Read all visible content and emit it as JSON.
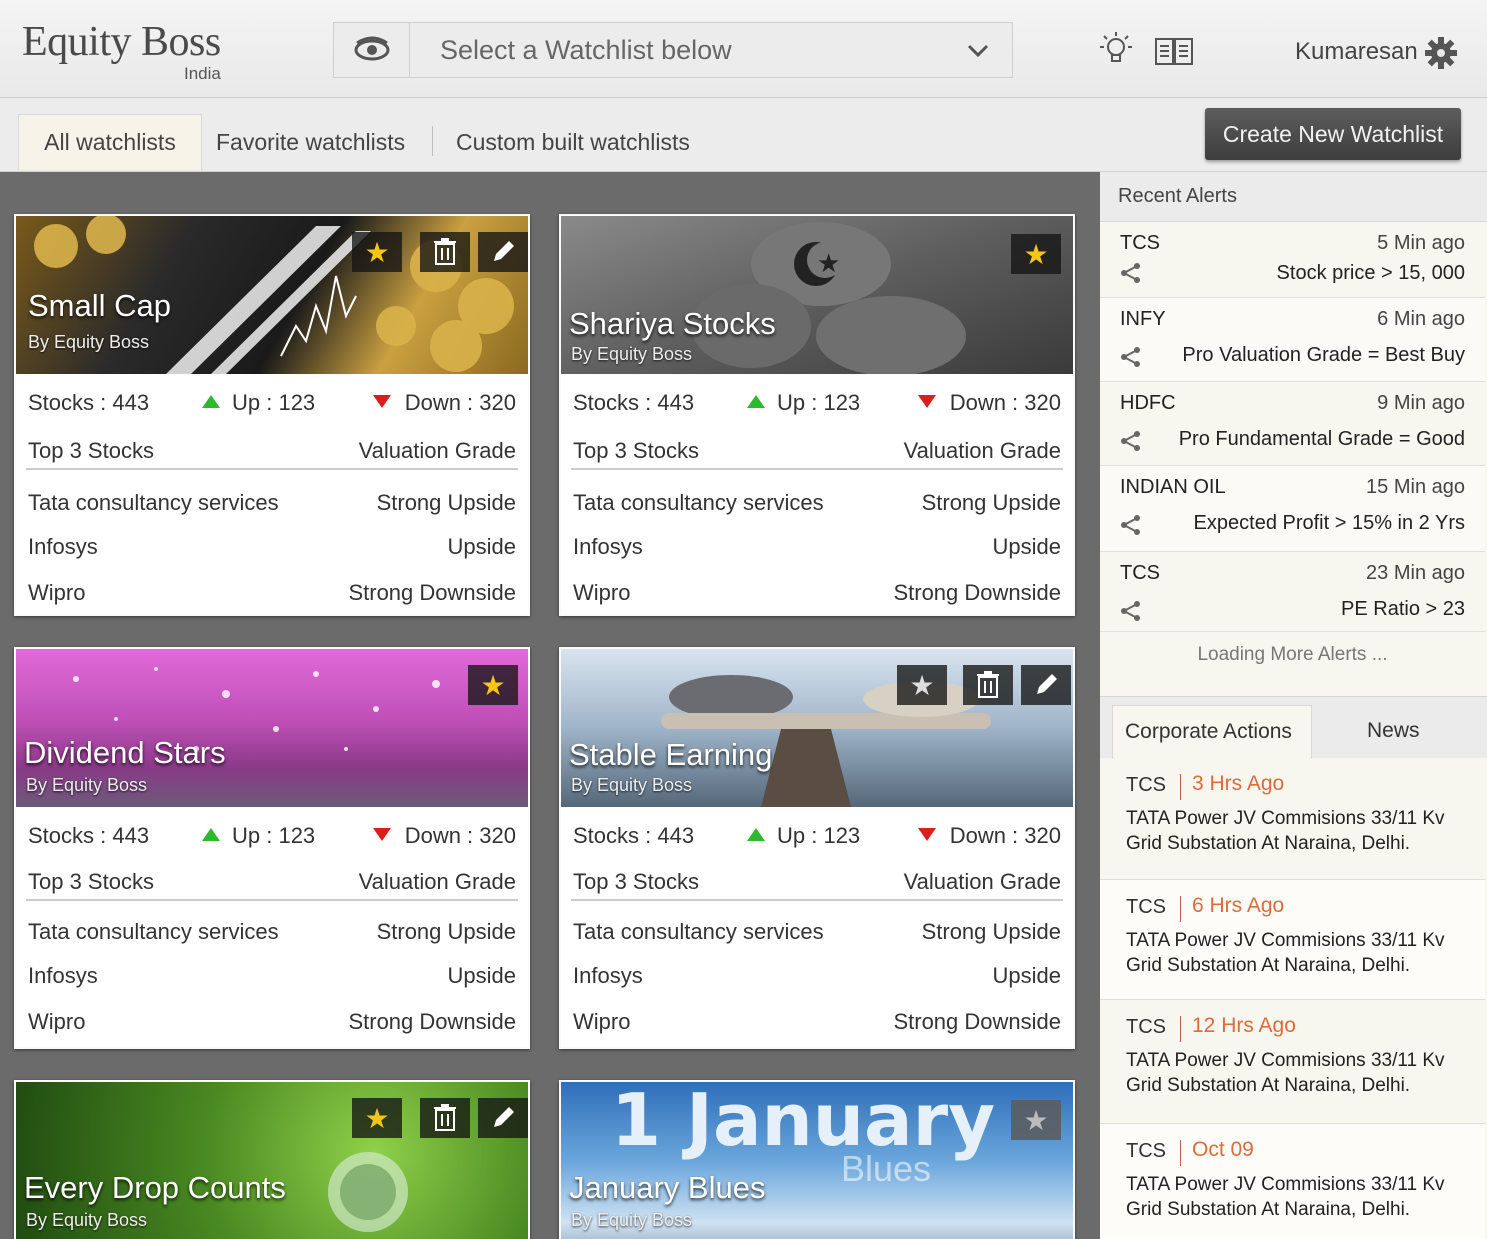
{
  "header": {
    "logo": "Equity Boss",
    "logo_sub": "India",
    "watchlist_select": "Select a Watchlist below",
    "user": "Kumaresan",
    "icons": [
      "eye-icon",
      "chevron-down-icon",
      "lightbulb-icon",
      "book-icon",
      "gear-icon"
    ]
  },
  "tabs": {
    "all": "All watchlists",
    "favorite": "Favorite watchlists",
    "custom": "Custom built watchlists",
    "create": "Create New Watchlist"
  },
  "labels": {
    "top3": "Top 3 Stocks",
    "valuation": "Valuation Grade"
  },
  "cards": [
    {
      "title": "Small Cap",
      "by": "By Equity Boss",
      "stocks": "Stocks  : 443",
      "up": "Up : 123",
      "down": "Down : 320",
      "rows": [
        [
          "Tata consultancy services",
          "Strong Upside"
        ],
        [
          "Infosys",
          "Upside"
        ],
        [
          "Wipro",
          "Strong Downside"
        ]
      ]
    },
    {
      "title": "Shariya Stocks",
      "by": "By Equity Boss",
      "stocks": "Stocks  : 443",
      "up": "Up : 123",
      "down": "Down : 320",
      "rows": [
        [
          "Tata consultancy services",
          "Strong Upside"
        ],
        [
          "Infosys",
          "Upside"
        ],
        [
          "Wipro",
          "Strong Downside"
        ]
      ]
    },
    {
      "title": "Dividend Stars",
      "by": "By Equity Boss",
      "stocks": "Stocks  : 443",
      "up": "Up : 123",
      "down": "Down : 320",
      "rows": [
        [
          "Tata consultancy services",
          "Strong Upside"
        ],
        [
          "Infosys",
          "Upside"
        ],
        [
          "Wipro",
          "Strong Downside"
        ]
      ]
    },
    {
      "title": "Stable Earning",
      "by": "By Equity Boss",
      "stocks": "Stocks  : 443",
      "up": "Up : 123",
      "down": "Down : 320",
      "rows": [
        [
          "Tata consultancy services",
          "Strong Upside"
        ],
        [
          "Infosys",
          "Upside"
        ],
        [
          "Wipro",
          "Strong Downside"
        ]
      ]
    },
    {
      "title": "Every Drop Counts",
      "by": "By Equity Boss"
    },
    {
      "title": "January Blues",
      "by": "By Equity Boss",
      "banner_text": "1 January",
      "banner_sub": "Blues"
    }
  ],
  "alerts": {
    "title": "Recent Alerts",
    "items": [
      {
        "sym": "TCS",
        "time": "5 Min ago",
        "cond": "Stock price > 15, 000"
      },
      {
        "sym": "INFY",
        "time": "6 Min ago",
        "cond": "Pro Valuation Grade = Best Buy"
      },
      {
        "sym": "HDFC",
        "time": "9 Min ago",
        "cond": "Pro Fundamental Grade = Good"
      },
      {
        "sym": "INDIAN OIL",
        "time": "15 Min ago",
        "cond": "Expected Profit > 15% in 2 Yrs"
      },
      {
        "sym": "TCS",
        "time": "23 Min ago",
        "cond": "PE Ratio > 23"
      }
    ],
    "loading": "Loading More Alerts ..."
  },
  "sidebar_tabs": {
    "corporate": "Corporate  Actions",
    "news": "News"
  },
  "news": [
    {
      "sym": "TCS",
      "age": "3 Hrs Ago",
      "text": "TATA Power JV Commisions 33/11 Kv Grid Substation At Naraina, Delhi."
    },
    {
      "sym": "TCS",
      "age": "6 Hrs Ago",
      "text": "TATA Power JV Commisions 33/11 Kv Grid Substation At Naraina, Delhi."
    },
    {
      "sym": "TCS",
      "age": "12 Hrs Ago",
      "text": "TATA Power JV Commisions 33/11 Kv Grid Substation At Naraina, Delhi."
    },
    {
      "sym": "TCS",
      "age": "Oct 09",
      "text": "TATA Power JV Commisions 33/11 Kv Grid Substation At Naraina, Delhi."
    }
  ],
  "colors": {
    "up": "#2eb82e",
    "down": "#d91e1e",
    "age": "#e06b3a",
    "star": "#f5c518"
  }
}
